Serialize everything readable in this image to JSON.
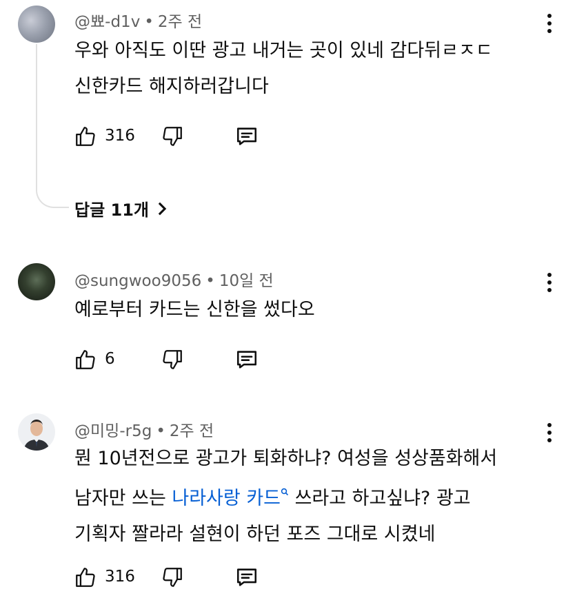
{
  "comments": [
    {
      "author": "@뾰-d1v",
      "time": "2주 전",
      "lines": [
        "우와 아직도 이딴 광고 내거는 곳이 있네 감다뒤ㄹㅈㄷ",
        "신한카드 해지하러갑니다"
      ],
      "likes": "316",
      "replies_label": "답글 11개"
    },
    {
      "author": "@sungwoo9056",
      "time": "10일 전",
      "lines": [
        "예로부터 카드는 신한을 썼다오"
      ],
      "likes": "6"
    },
    {
      "author": "@미밍-r5g",
      "time": "2주 전",
      "line1": "뭔 10년전으로 광고가 퇴화하냐? 여성을 성상품화해서",
      "line2_before": "남자만 쓰는 ",
      "line2_link": "나라사랑 카드",
      "line2_after": " 쓰라고 하고싶냐? 광고",
      "line3": "기획자 짤라라 설현이 하던 포즈 그대로 시켰네",
      "likes": "316"
    }
  ],
  "icons": {
    "like": "thumbs-up-icon",
    "dislike": "thumbs-down-icon",
    "reply": "reply-icon",
    "more": "more-vert-icon",
    "search_hint": "search-icon",
    "chevron": "chevron-right-icon"
  },
  "colors": {
    "link": "#065fd4",
    "meta": "#606060",
    "text": "#0f0f0f"
  }
}
